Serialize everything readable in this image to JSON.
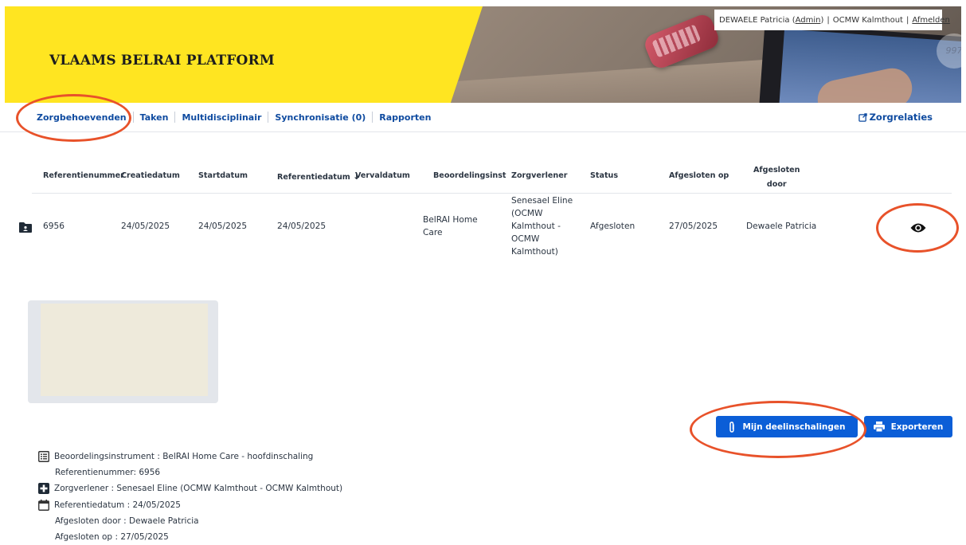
{
  "header": {
    "brand": "VLAAMS BELRAI PLATFORM",
    "photo_badge": "997",
    "user": {
      "name_prefix": "DEWAELE Patricia (",
      "role_link": " Admin",
      "name_suffix": ")",
      "org": "OCMW Kalmthout",
      "logout": "Afmelden"
    }
  },
  "nav": {
    "items": [
      "Zorgbehoevenden",
      "Taken",
      "Multidisciplinair",
      "Synchronisatie (0)",
      "Rapporten"
    ],
    "right": "Zorgrelaties"
  },
  "table": {
    "headers": {
      "ref": "Referentienummer",
      "created": "Creatiedatum",
      "start": "Startdatum",
      "refdate": "Referentiedatum",
      "due": "Vervaldatum",
      "instrument": "Beoordelingsinstrun",
      "caregiver": "Zorgverlener",
      "status": "Status",
      "closed_on": "Afgesloten op",
      "closed_by_1": "Afgesloten",
      "closed_by_2": "door"
    },
    "row": {
      "ref": "6956",
      "created": "24/05/2025",
      "start": "24/05/2025",
      "refdate": "24/05/2025",
      "instrument_1": "BelRAI Home",
      "instrument_2": "Care",
      "caregiver_lines": [
        "Senesael Eline",
        "(OCMW",
        "Kalmthout -",
        "OCMW",
        "Kalmthout)"
      ],
      "status": "Afgesloten",
      "closed_on": "27/05/2025",
      "closed_by": "Dewaele Patricia"
    }
  },
  "buttons": {
    "deelinschalingen": "Mijn deelinschalingen",
    "export": "Exporteren"
  },
  "details": {
    "instrument": "Beoordelingsinstrument : BelRAI Home Care  - hoofdinschaling",
    "refnum": "Referentienummer: 6956",
    "caregiver": "Zorgverlener : Senesael Eline (OCMW Kalmthout - OCMW Kalmthout)",
    "refdate": "Referentiedatum : 24/05/2025",
    "closed_by": "Afgesloten door : Dewaele Patricia",
    "closed_on": "Afgesloten op : 27/05/2025"
  },
  "colors": {
    "brand_yellow": "#ffe521",
    "link_blue": "#0f4ba0",
    "button_blue": "#0b5ed7",
    "annotation_orange": "#e8522a"
  }
}
